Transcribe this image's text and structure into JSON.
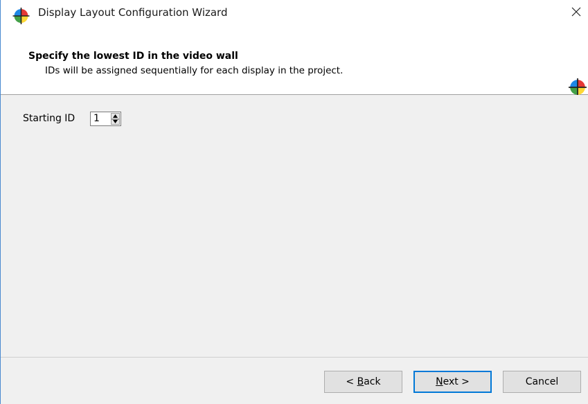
{
  "window": {
    "title": "Display Layout Configuration Wizard"
  },
  "header": {
    "title": "Specify the lowest ID in the video wall",
    "subtitle": "IDs will be assigned sequentially for each display in the project."
  },
  "form": {
    "starting_id_label": "Starting ID",
    "starting_id_value": "1"
  },
  "buttons": {
    "back_prefix": "< ",
    "back_mnemonic": "B",
    "back_rest": "ack",
    "next_mnemonic": "N",
    "next_rest": "ext >",
    "cancel": "Cancel"
  },
  "colors": {
    "focus_accent": "#0078d7",
    "window_border": "#4a8ad0"
  },
  "icons": {
    "app": "color-wheel-icon",
    "close": "close-icon",
    "spin_up": "arrow-up-icon",
    "spin_down": "arrow-down-icon"
  }
}
